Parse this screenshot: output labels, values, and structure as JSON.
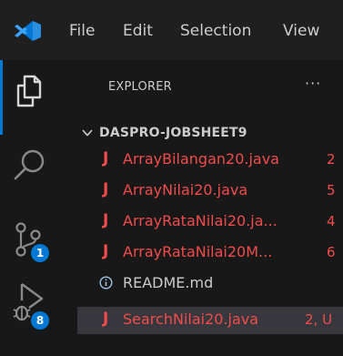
{
  "menu": {
    "file": "File",
    "edit": "Edit",
    "selection": "Selection",
    "view": "View"
  },
  "activity_bar": {
    "items": [
      {
        "icon": "files-icon",
        "active": true
      },
      {
        "icon": "search-icon"
      },
      {
        "icon": "source-control-icon",
        "badge": "1"
      },
      {
        "icon": "run-debug-icon",
        "badge": "8"
      }
    ]
  },
  "explorer": {
    "title": "EXPLORER",
    "more_actions": "···",
    "folder": "DASPRO-JOBSHEET9",
    "files": [
      {
        "name": "ArrayBilangan20.java",
        "status": "2",
        "icon": "java-icon"
      },
      {
        "name": "ArrayNilai20.java",
        "status": "5",
        "icon": "java-icon"
      },
      {
        "name": "ArrayRataNilai20.ja...",
        "status": "4",
        "icon": "java-icon"
      },
      {
        "name": "ArrayRataNilai20M...",
        "status": "6",
        "icon": "java-icon"
      },
      {
        "name": "README.md",
        "status": "",
        "icon": "info-icon"
      },
      {
        "name": "SearchNilai20.java",
        "status": "2, U",
        "icon": "java-icon",
        "selected": true
      }
    ]
  },
  "colors": {
    "accent": "#0078d4",
    "error": "#f14c4c",
    "background": "#181818",
    "selection": "#37373d"
  }
}
